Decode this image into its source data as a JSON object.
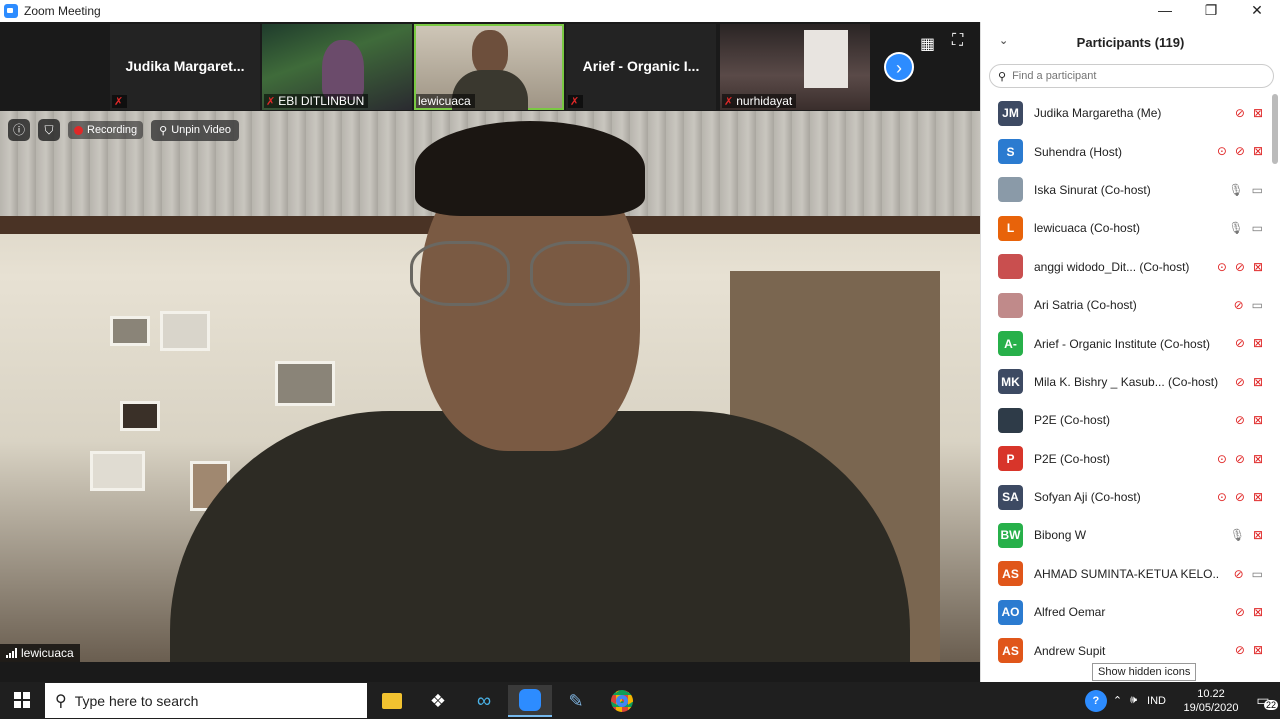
{
  "window": {
    "title": "Zoom Meeting",
    "controls": [
      "—",
      "❐",
      "✕"
    ]
  },
  "thumbnails": [
    {
      "name": "Judika  Margaret...",
      "label": "",
      "muted": true,
      "type": "name"
    },
    {
      "name": "",
      "label": "EBI DITLINBUN",
      "muted": true,
      "type": "video"
    },
    {
      "name": "",
      "label": "lewicuaca",
      "muted": false,
      "type": "video",
      "active": true
    },
    {
      "name": "Arief  -  Organic I...",
      "label": "",
      "muted": true,
      "type": "name"
    },
    {
      "name": "",
      "label": "nurhidayat",
      "muted": true,
      "type": "video"
    }
  ],
  "main": {
    "recording_label": "Recording",
    "unpin_label": "Unpin Video",
    "speaker": "lewicuaca"
  },
  "panel": {
    "title": "Participants (119)",
    "search_placeholder": "Find a participant",
    "participants": [
      {
        "initials": "JM",
        "color": "#3d4a63",
        "name": "Judika Margaretha (Me)",
        "rec": false,
        "mic": "off",
        "vid": "off"
      },
      {
        "initials": "S",
        "color": "#2b7bd0",
        "name": "Suhendra (Host)",
        "rec": true,
        "mic": "off",
        "vid": "off"
      },
      {
        "initials": "",
        "color": "#8a9aa8",
        "name": "Iska Sinurat (Co-host)",
        "rec": false,
        "mic": "on",
        "vid": "on"
      },
      {
        "initials": "L",
        "color": "#e8630a",
        "name": "lewicuaca (Co-host)",
        "rec": false,
        "mic": "on",
        "vid": "on"
      },
      {
        "initials": "",
        "color": "#c94f4f",
        "name": "anggi widodo_Dit... (Co-host)",
        "rec": true,
        "mic": "off",
        "vid": "off"
      },
      {
        "initials": "",
        "color": "#c08a8a",
        "name": "Ari Satria (Co-host)",
        "rec": false,
        "mic": "off",
        "vid": "on"
      },
      {
        "initials": "A-",
        "color": "#27b04a",
        "name": "Arief - Organic Institute (Co-host)",
        "rec": false,
        "mic": "off",
        "vid": "off"
      },
      {
        "initials": "MK",
        "color": "#3d4a63",
        "name": "Mila K. Bishry _ Kasub... (Co-host)",
        "rec": false,
        "mic": "off",
        "vid": "off"
      },
      {
        "initials": "",
        "color": "#2e3b48",
        "name": "P2E (Co-host)",
        "rec": false,
        "mic": "off",
        "vid": "off"
      },
      {
        "initials": "P",
        "color": "#d8352a",
        "name": "P2E (Co-host)",
        "rec": true,
        "mic": "off",
        "vid": "off"
      },
      {
        "initials": "SA",
        "color": "#3d4a63",
        "name": "Sofyan Aji (Co-host)",
        "rec": true,
        "mic": "off",
        "vid": "off"
      },
      {
        "initials": "BW",
        "color": "#27b04a",
        "name": "Bibong W",
        "rec": false,
        "mic": "on",
        "vid": "off"
      },
      {
        "initials": "AS",
        "color": "#e0561a",
        "name": "AHMAD SUMINTA-KETUA KELO...",
        "rec": false,
        "mic": "off",
        "vid": "on"
      },
      {
        "initials": "AO",
        "color": "#2b7bd0",
        "name": "Alfred Oemar",
        "rec": false,
        "mic": "off",
        "vid": "off"
      },
      {
        "initials": "AS",
        "color": "#e0561a",
        "name": "Andrew Supit",
        "rec": false,
        "mic": "off",
        "vid": "off"
      }
    ],
    "tooltip": "Show hidden icons"
  },
  "taskbar": {
    "search_placeholder": "Type here to search",
    "language": "IND",
    "time": "10.22",
    "date": "19/05/2020",
    "notification_count": "22"
  }
}
